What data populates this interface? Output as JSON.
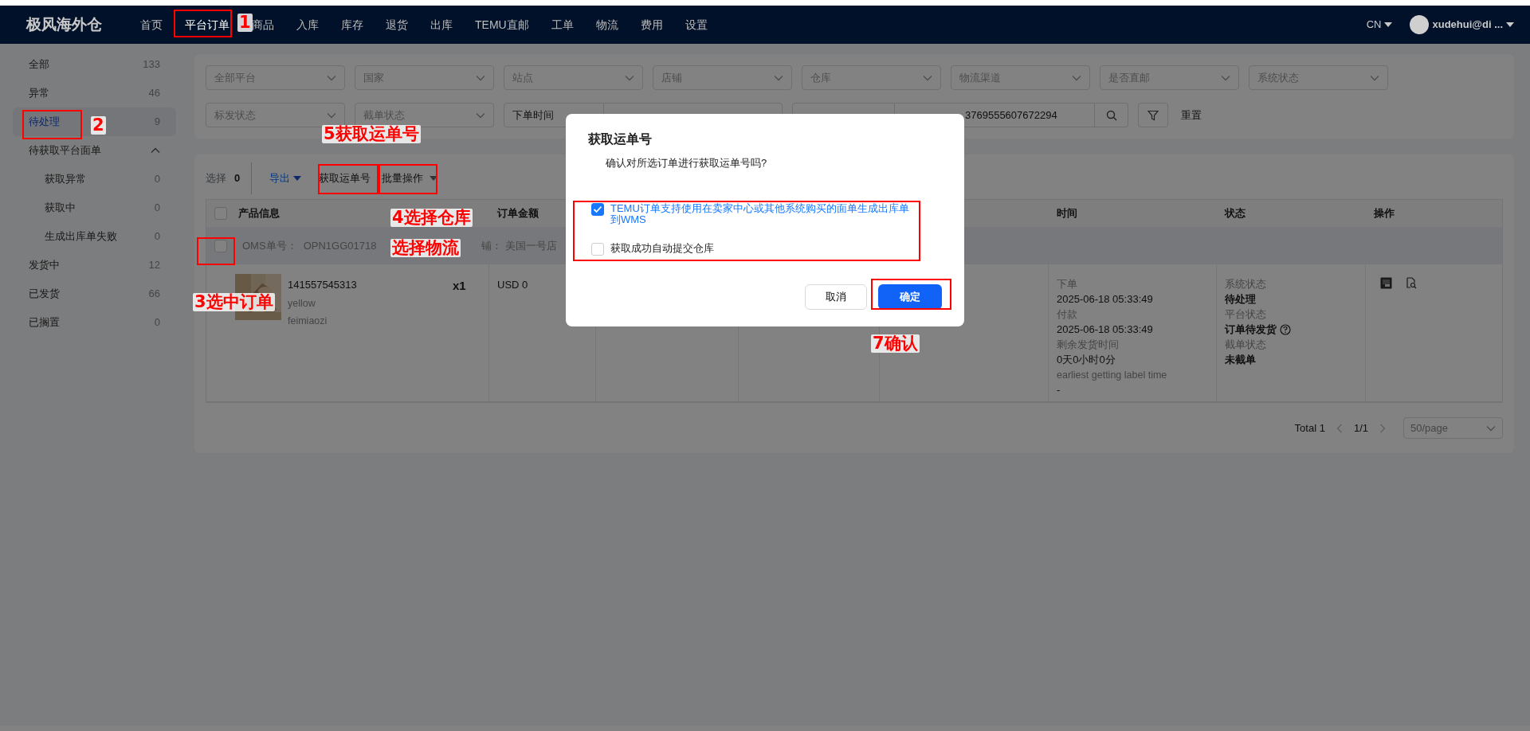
{
  "logo": "极风海外仓",
  "nav": [
    {
      "label": "首页",
      "selected": false
    },
    {
      "label": "平台订单",
      "selected": true
    },
    {
      "label": "商品",
      "selected": false
    },
    {
      "label": "入库",
      "selected": false
    },
    {
      "label": "库存",
      "selected": false
    },
    {
      "label": "退货",
      "selected": false
    },
    {
      "label": "出库",
      "selected": false
    },
    {
      "label": "TEMU直邮",
      "selected": false
    },
    {
      "label": "工单",
      "selected": false
    },
    {
      "label": "物流",
      "selected": false
    },
    {
      "label": "费用",
      "selected": false
    },
    {
      "label": "设置",
      "selected": false
    }
  ],
  "language": "CN",
  "user": "xudehui@di ...",
  "sidebar": [
    {
      "label": "全部",
      "count": "133",
      "selected": false
    },
    {
      "label": "异常",
      "count": "46",
      "selected": false
    },
    {
      "label": "待处理",
      "count": "9",
      "selected": true
    },
    {
      "label": "待获取平台面单",
      "selected": false,
      "expanded": true,
      "children": [
        {
          "label": "获取异常",
          "count": "0",
          "selected": false
        },
        {
          "label": "获取中",
          "count": "0",
          "selected": false
        },
        {
          "label": "生成出库单失败",
          "count": "0",
          "selected": false
        }
      ]
    },
    {
      "label": "发货中",
      "count": "12",
      "selected": false
    },
    {
      "label": "已发货",
      "count": "66",
      "selected": false
    },
    {
      "label": "已搁置",
      "count": "0",
      "selected": false
    }
  ],
  "filters": [
    {
      "placeholder": "全部平台"
    },
    {
      "placeholder": "国家"
    },
    {
      "placeholder": "站点"
    },
    {
      "placeholder": "店铺"
    },
    {
      "placeholder": "仓库"
    },
    {
      "placeholder": "物流渠道"
    },
    {
      "placeholder": "是否直邮"
    },
    {
      "placeholder": "系统状态"
    },
    {
      "placeholder": "标发状态"
    },
    {
      "placeholder": "截单状态"
    }
  ],
  "date_filter": {
    "label": "下单时间"
  },
  "search": {
    "value": "3769555607672294"
  },
  "reset": "重置",
  "toolbar": {
    "select_label": "选择",
    "select_count": "0",
    "export": "导出",
    "get_waybill": "获取运单号",
    "batch": "批量操作"
  },
  "table": {
    "columns": [
      "产品信息",
      "订单金额",
      "时间",
      "状态",
      "操作"
    ],
    "header_checked": false,
    "group": {
      "checked": false,
      "oms_label": "OMS单号：",
      "oms_no": "OPN1GG01718",
      "store_label": "铺：",
      "store": "美国一号店"
    },
    "row": {
      "sku": "141557545313",
      "variant": "yellow",
      "name": "feimiaozi",
      "qty": "x1",
      "amount": "USD 0",
      "times": [
        {
          "label": "下单",
          "value": "2025-06-18 05:33:49"
        },
        {
          "label": "付款",
          "value": "2025-06-18 05:33:49"
        },
        {
          "label": "剩余发货时间",
          "value": "0天0小时0分"
        },
        {
          "label": "earliest getting label time",
          "value": "-"
        }
      ],
      "statuses": [
        {
          "label": "系统状态",
          "value": "待处理",
          "help": false
        },
        {
          "label": "平台状态",
          "value": "订单待发货",
          "help": true
        },
        {
          "label": "截单状态",
          "value": "未截单",
          "help": false
        }
      ]
    }
  },
  "pagination": {
    "total": "Total 1",
    "page": "1/1",
    "page_size": "50/page"
  },
  "modal": {
    "title": "获取运单号",
    "message": "确认对所选订单进行获取运单号吗?",
    "options": [
      {
        "label": "TEMU订单支持使用在卖家中心或其他系统购买的面单生成出库单到WMS",
        "checked": true
      },
      {
        "label": "获取成功自动提交仓库",
        "checked": false
      }
    ],
    "cancel": "取消",
    "ok": "确定"
  },
  "annotation_labels": [
    "1",
    "2",
    "3选中订单",
    "4选择仓库",
    "选择物流",
    "5获取运单号",
    "7确认"
  ]
}
